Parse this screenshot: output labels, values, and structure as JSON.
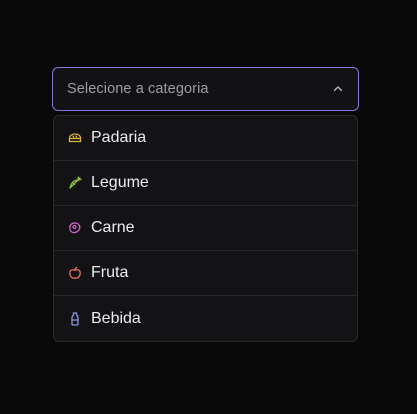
{
  "select": {
    "placeholder": "Selecione a categoria",
    "expanded_icon": "chevron-up-icon",
    "accent_color": "#8d74d6"
  },
  "options": [
    {
      "label": "Padaria",
      "icon": "bread-icon",
      "color": "#e0b43c"
    },
    {
      "label": "Legume",
      "icon": "carrot-icon",
      "color": "#8fc043"
    },
    {
      "label": "Carne",
      "icon": "meat-icon",
      "color": "#d65ccf"
    },
    {
      "label": "Fruta",
      "icon": "apple-icon",
      "color": "#e66c5a"
    },
    {
      "label": "Bebida",
      "icon": "bottle-icon",
      "color": "#8e96e6"
    }
  ]
}
